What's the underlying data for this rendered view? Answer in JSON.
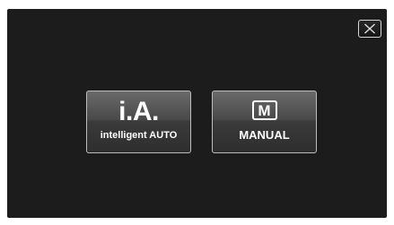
{
  "close_button": {
    "icon": "close-icon"
  },
  "modes": {
    "intelligent_auto": {
      "icon_text": "i.A.",
      "label": "intelligent AUTO"
    },
    "manual": {
      "icon_text": "M",
      "label": "MANUAL"
    }
  },
  "colors": {
    "screen_background": "#1c1c1c",
    "button_border": "#bdbdbd",
    "text": "#ffffff"
  }
}
